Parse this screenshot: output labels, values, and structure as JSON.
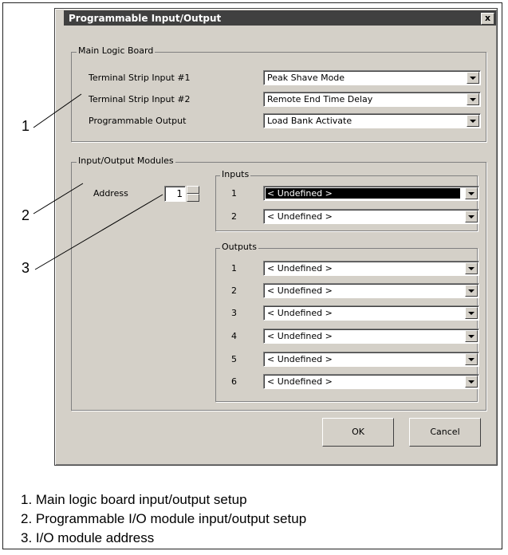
{
  "dialog": {
    "title": "Programmable Input/Output",
    "close_label": "x"
  },
  "main_logic_board": {
    "legend": "Main Logic Board",
    "rows": [
      {
        "label": "Terminal Strip Input #1",
        "value": "Peak Shave Mode"
      },
      {
        "label": "Terminal Strip Input #2",
        "value": "Remote End Time Delay"
      },
      {
        "label": "Programmable Output",
        "value": "Load Bank Activate"
      }
    ]
  },
  "io_modules": {
    "legend": "Input/Output Modules",
    "address_label": "Address",
    "address_value": "1",
    "inputs": {
      "legend": "Inputs",
      "rows": [
        {
          "num": "1",
          "value": "< Undefined >"
        },
        {
          "num": "2",
          "value": "< Undefined >"
        }
      ]
    },
    "outputs": {
      "legend": "Outputs",
      "rows": [
        {
          "num": "1",
          "value": "< Undefined >"
        },
        {
          "num": "2",
          "value": "< Undefined >"
        },
        {
          "num": "3",
          "value": "< Undefined >"
        },
        {
          "num": "4",
          "value": "< Undefined >"
        },
        {
          "num": "5",
          "value": "< Undefined >"
        },
        {
          "num": "6",
          "value": "< Undefined >"
        }
      ]
    }
  },
  "buttons": {
    "ok": "OK",
    "cancel": "Cancel"
  },
  "callouts": [
    "1",
    "2",
    "3"
  ],
  "captions": [
    "1.  Main logic board input/output setup",
    "2.  Programmable I/O module input/output setup",
    "3.  I/O module address"
  ]
}
